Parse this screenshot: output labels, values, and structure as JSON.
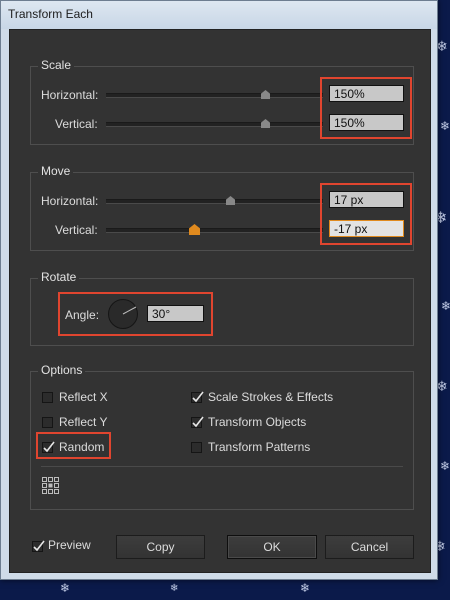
{
  "window": {
    "title": "Transform Each"
  },
  "scale": {
    "legend": "Scale",
    "horizontal": {
      "label": "Horizontal:",
      "value": "150%"
    },
    "vertical": {
      "label": "Vertical:",
      "value": "150%"
    }
  },
  "move": {
    "legend": "Move",
    "horizontal": {
      "label": "Horizontal:",
      "value": "17 px"
    },
    "vertical": {
      "label": "Vertical:",
      "value": "-17 px"
    }
  },
  "rotate": {
    "legend": "Rotate",
    "angle": {
      "label": "Angle:",
      "value": "30°"
    }
  },
  "options": {
    "legend": "Options",
    "reflect_x": {
      "label": "Reflect X",
      "checked": false
    },
    "reflect_y": {
      "label": "Reflect Y",
      "checked": false
    },
    "random": {
      "label": "Random",
      "checked": true
    },
    "scale_strokes": {
      "label": "Scale Strokes & Effects",
      "checked": true
    },
    "transform_objects": {
      "label": "Transform Objects",
      "checked": true
    },
    "transform_patterns": {
      "label": "Transform Patterns",
      "checked": false
    }
  },
  "footer": {
    "preview": {
      "label": "Preview",
      "checked": true
    },
    "copy_label": "Copy",
    "ok_label": "OK",
    "cancel_label": "Cancel"
  },
  "colors": {
    "highlight": "#e0452f",
    "dialog_bg": "#333333",
    "active_thumb": "#e08a1e"
  }
}
